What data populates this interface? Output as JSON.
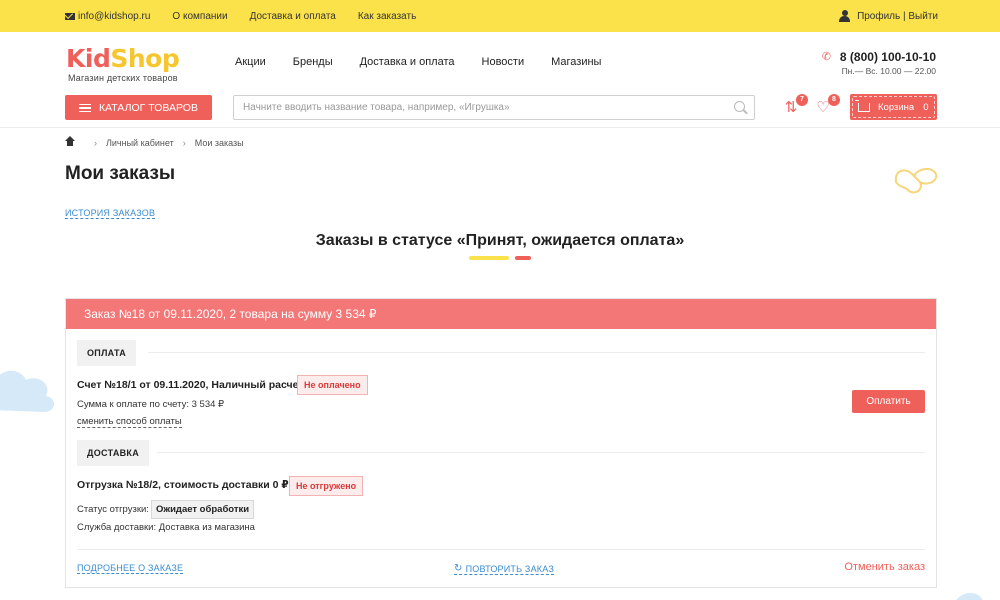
{
  "topbar": {
    "email": "info@kidshop.ru",
    "links": [
      "О компании",
      "Доставка и оплата",
      "Как заказать"
    ],
    "profile": "Профиль | Выйти"
  },
  "header": {
    "logo_part1": "Kid",
    "logo_part2": "Shop",
    "logo_sub": "Магазин детских товаров",
    "nav": [
      "Акции",
      "Бренды",
      "Доставка и оплата",
      "Новости",
      "Магазины"
    ],
    "phone": "8 (800) 100-10-10",
    "hours": "Пн.— Вс. 10.00 — 22.00",
    "catalog_label": "КАТАЛОГ ТОВАРОВ",
    "search_placeholder": "Начните вводить название товара, например, «Игрушка»",
    "compare_count": "7",
    "favorites_count": "8",
    "cart_label": "Корзина",
    "cart_count": "0"
  },
  "breadcrumb": {
    "items": [
      "Личный кабинет",
      "Мои заказы"
    ]
  },
  "page": {
    "title": "Мои заказы",
    "history_link": "ИСТОРИЯ ЗАКАЗОВ",
    "subtitle": "Заказы в статусе «Принят, ожидается оплата»"
  },
  "colors": {
    "yellow": "#fbe24a",
    "accent": "#f0605a",
    "order_header": "#f47777",
    "link": "#3a8cd0"
  },
  "order": {
    "header": "Заказ №18 от 09.11.2020, 2 товара на сумму 3 534 ₽",
    "payment": {
      "section_label": "ОПЛАТА",
      "invoice": "Счет №18/1 от 09.11.2020, Наличный расчет",
      "status": "Не оплачено",
      "amount": "Сумма к оплате по счету: 3 534 ₽",
      "change_method": "сменить способ оплаты",
      "pay_button": "Оплатить"
    },
    "delivery": {
      "section_label": "ДОСТАВКА",
      "shipment": "Отгрузка №18/2, стоимость доставки 0 ₽",
      "status": "Не отгружено",
      "shipment_status_label": "Статус отгрузки:",
      "shipment_status_value": "Ожидает обработки",
      "service": "Служба доставки: Доставка из магазина"
    },
    "footer": {
      "details": "ПОДРОБНЕЕ О ЗАКАЗЕ",
      "repeat": "ПОВТОРИТЬ ЗАКАЗ",
      "cancel": "Отменить заказ"
    }
  }
}
